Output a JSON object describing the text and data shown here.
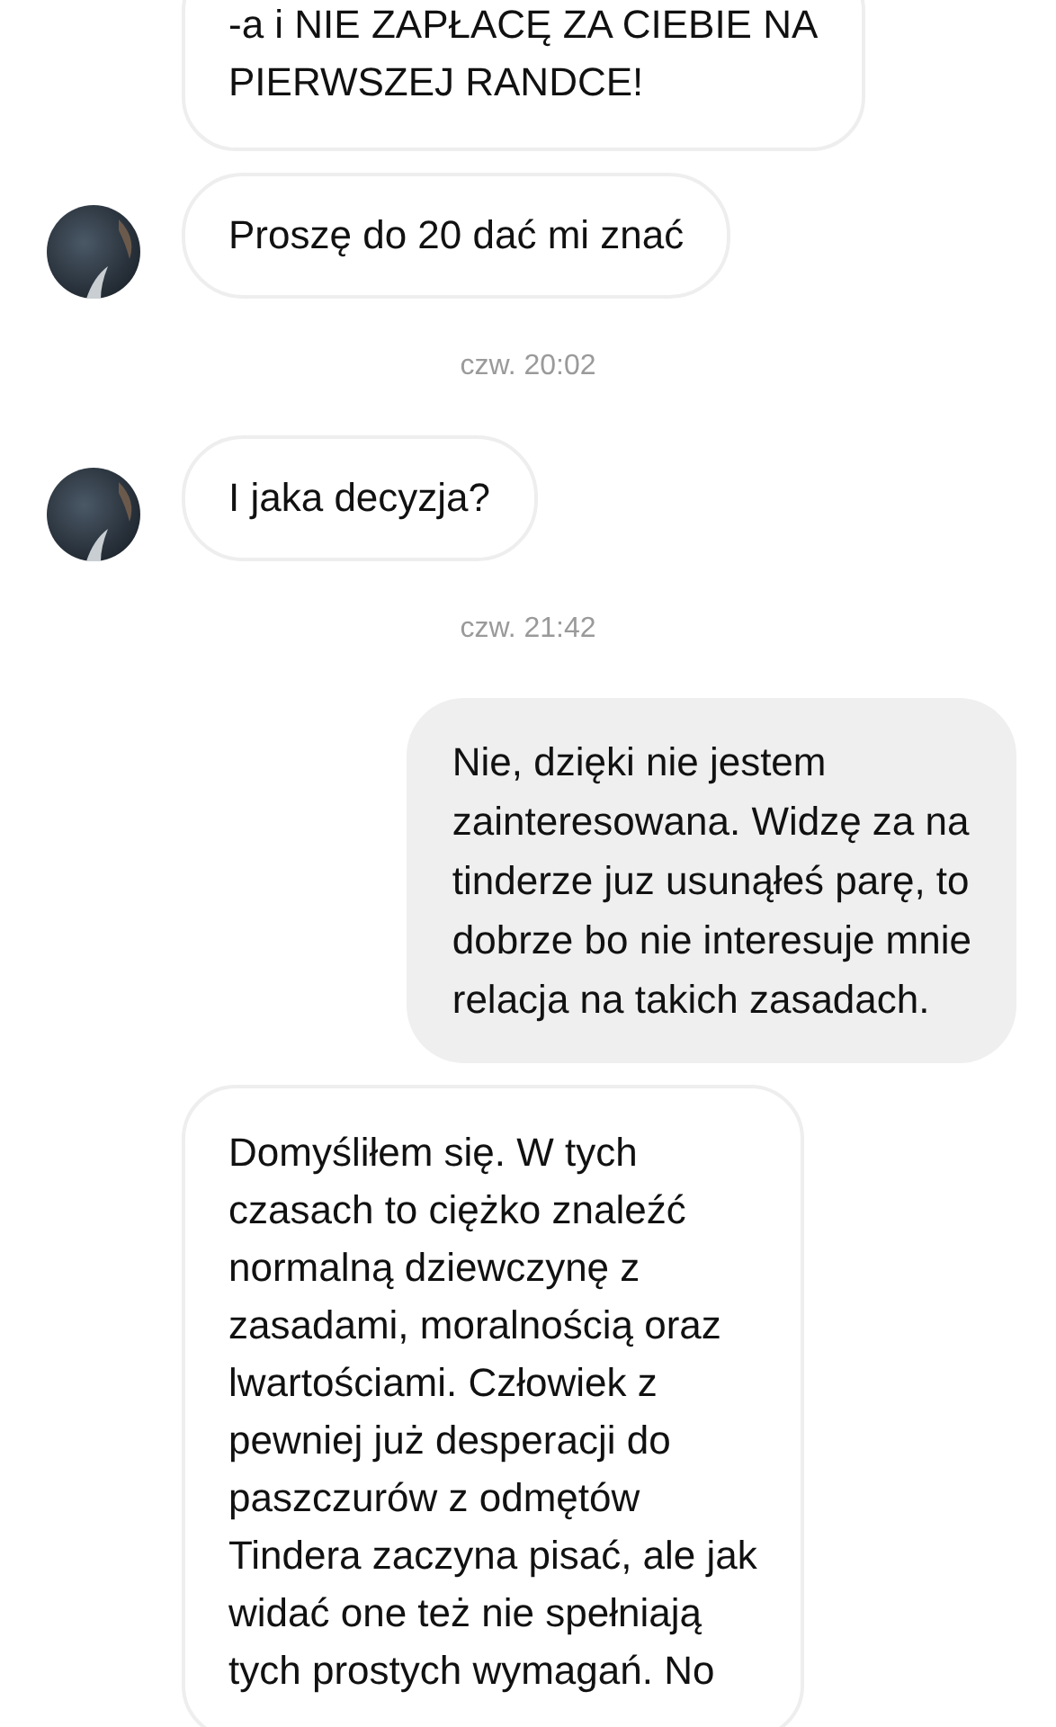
{
  "messages": [
    {
      "kind": "received",
      "avatar": false,
      "text": "-a i NIE ZAPŁACĘ ZA CIEBIE NA\nPIERWSZEJ RANDCE!"
    },
    {
      "kind": "received",
      "avatar": true,
      "text": "Proszę do 20 dać mi znać"
    },
    {
      "kind": "timestamp",
      "text": "czw. 20:02"
    },
    {
      "kind": "received",
      "avatar": true,
      "text": "I jaka decyzja?"
    },
    {
      "kind": "timestamp",
      "text": "czw. 21:42"
    },
    {
      "kind": "sent",
      "text": "Nie, dzięki nie jestem\nzainteresowana. Widzę za na\ntinderze juz usunąłeś parę, to\ndobrze bo nie interesuje mnie\nrelacja na takich zasadach."
    },
    {
      "kind": "received",
      "avatar": false,
      "text": "Domyśliłem się. W tych\nczasach to ciężko znaleźć\nnormalną dziewczynę z\nzasadami, moralnością oraz\nlwartościami. Człowiek z\npewniej już desperacji do\npaszczurów z odmętów\nTindera zaczyna pisać, ale jak\nwidać one też nie spełniają\ntych prostych wymagań. No"
    }
  ]
}
